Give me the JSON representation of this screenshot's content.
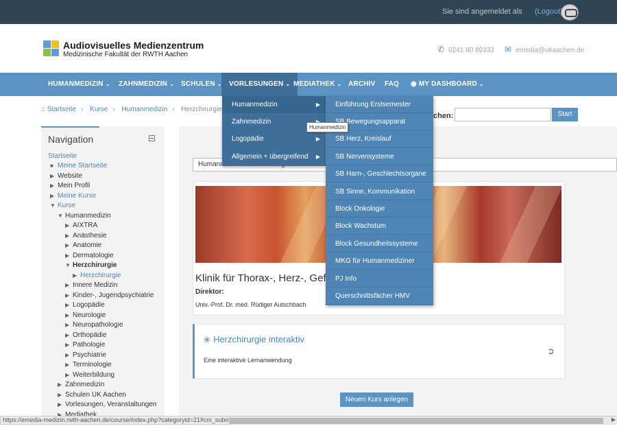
{
  "topbar": {
    "login_text": "Sie sind angemeldet als",
    "logout_label": "(Logout)"
  },
  "header": {
    "logo_title": "Audiovisuelles Medienzentrum",
    "logo_subtitle": "Medizinische Fakultät der RWTH Aachen",
    "phone": "0241 80 89333",
    "email": "emedia@ukaachen.de"
  },
  "nav": {
    "items": [
      {
        "label": "HUMANMEDIZIN"
      },
      {
        "label": "ZAHNMEDIZIN"
      },
      {
        "label": "SCHULEN"
      },
      {
        "label": "VORLESUNGEN"
      },
      {
        "label": "MEDIATHEK"
      },
      {
        "label": "ARCHIV"
      },
      {
        "label": "FAQ"
      },
      {
        "label": "MY DASHBOARD"
      }
    ],
    "active_index": 3
  },
  "breadcrumb": {
    "items": [
      "Startseite",
      "Kurse",
      "Humanmedizin",
      "Herzchirurgie"
    ]
  },
  "search": {
    "label": "chen:",
    "value": "",
    "button_label": "Start"
  },
  "sidebar": {
    "title": "Navigation",
    "tree": [
      {
        "label": "Startseite"
      },
      {
        "label": "Meine Startseite"
      },
      {
        "label": "Website"
      },
      {
        "label": "Mein Profil"
      },
      {
        "label": "Meine Kurse"
      },
      {
        "label": "Kurse"
      },
      {
        "label": "Humanmedizin"
      },
      {
        "label": "AIXTRA"
      },
      {
        "label": "Anästhesie"
      },
      {
        "label": "Anatomie"
      },
      {
        "label": "Dermatologie"
      },
      {
        "label": "Herzchirurgie"
      },
      {
        "label": "Herzchirurgie"
      },
      {
        "label": "Innere Medizin"
      },
      {
        "label": "Kinder-, Jugendpsychiatrie"
      },
      {
        "label": "Logopädie"
      },
      {
        "label": "Neurologie"
      },
      {
        "label": "Neuropathologie"
      },
      {
        "label": "Orthopädie"
      },
      {
        "label": "Pathologie"
      },
      {
        "label": "Psychiatrie"
      },
      {
        "label": "Terminologie"
      },
      {
        "label": "Weiterbildung"
      },
      {
        "label": "Zahnmedizin"
      },
      {
        "label": "Schulen UK Aachen"
      },
      {
        "label": "Vorlesungen, Veranstaltungen"
      },
      {
        "label": "Mediathek"
      }
    ]
  },
  "main": {
    "category_select": "Humanmedizin / Herzchirurgie",
    "course_title": "Klinik für Thorax-, Herz-, Gefä",
    "course_role": "Direktor:",
    "course_director": "Univ.-Prof. Dr. med. Rüdiger Autschbach",
    "interactive_title": "Herzchirurgie interaktiv",
    "interactive_desc": "Eine interaktive Lernanwendung",
    "new_course_button": "Neuen Kurs anlegen"
  },
  "menu_vorlesungen": {
    "items": [
      {
        "label": "Humanmedizin"
      },
      {
        "label": "Zahnmedizin"
      },
      {
        "label": "Logopädie"
      },
      {
        "label": "Allgemein + übergreifend"
      }
    ],
    "selected_index": 0
  },
  "menu_humanmedizin": {
    "items": [
      {
        "label": "Einführung Erstsemester"
      },
      {
        "label": "SB Bewegungsapparat"
      },
      {
        "label": "SB Herz, Kreislauf"
      },
      {
        "label": "SB Nervensysteme"
      },
      {
        "label": "SB Harn-, Geschlechtsorgane"
      },
      {
        "label": "SB Sinne, Kommunikation"
      },
      {
        "label": "Block Onkologie"
      },
      {
        "label": "Block Wachstum"
      },
      {
        "label": "Block Gesundheitssysteme"
      },
      {
        "label": "MKG für Humanmediziner"
      },
      {
        "label": "PJ Info"
      },
      {
        "label": "Querschnittsfächer HMV"
      }
    ]
  },
  "tooltip": {
    "text": "Humanmedizin"
  },
  "statusbar": {
    "url": "https://emedia-medizin.rwth-aachen.de/course/index.php?categoryid=21#cm_submenu_5"
  },
  "colors": {
    "topbar": "#2f4455",
    "nav": "#5b94c3",
    "nav_active": "#3f6f99",
    "link": "#4a86bf"
  }
}
